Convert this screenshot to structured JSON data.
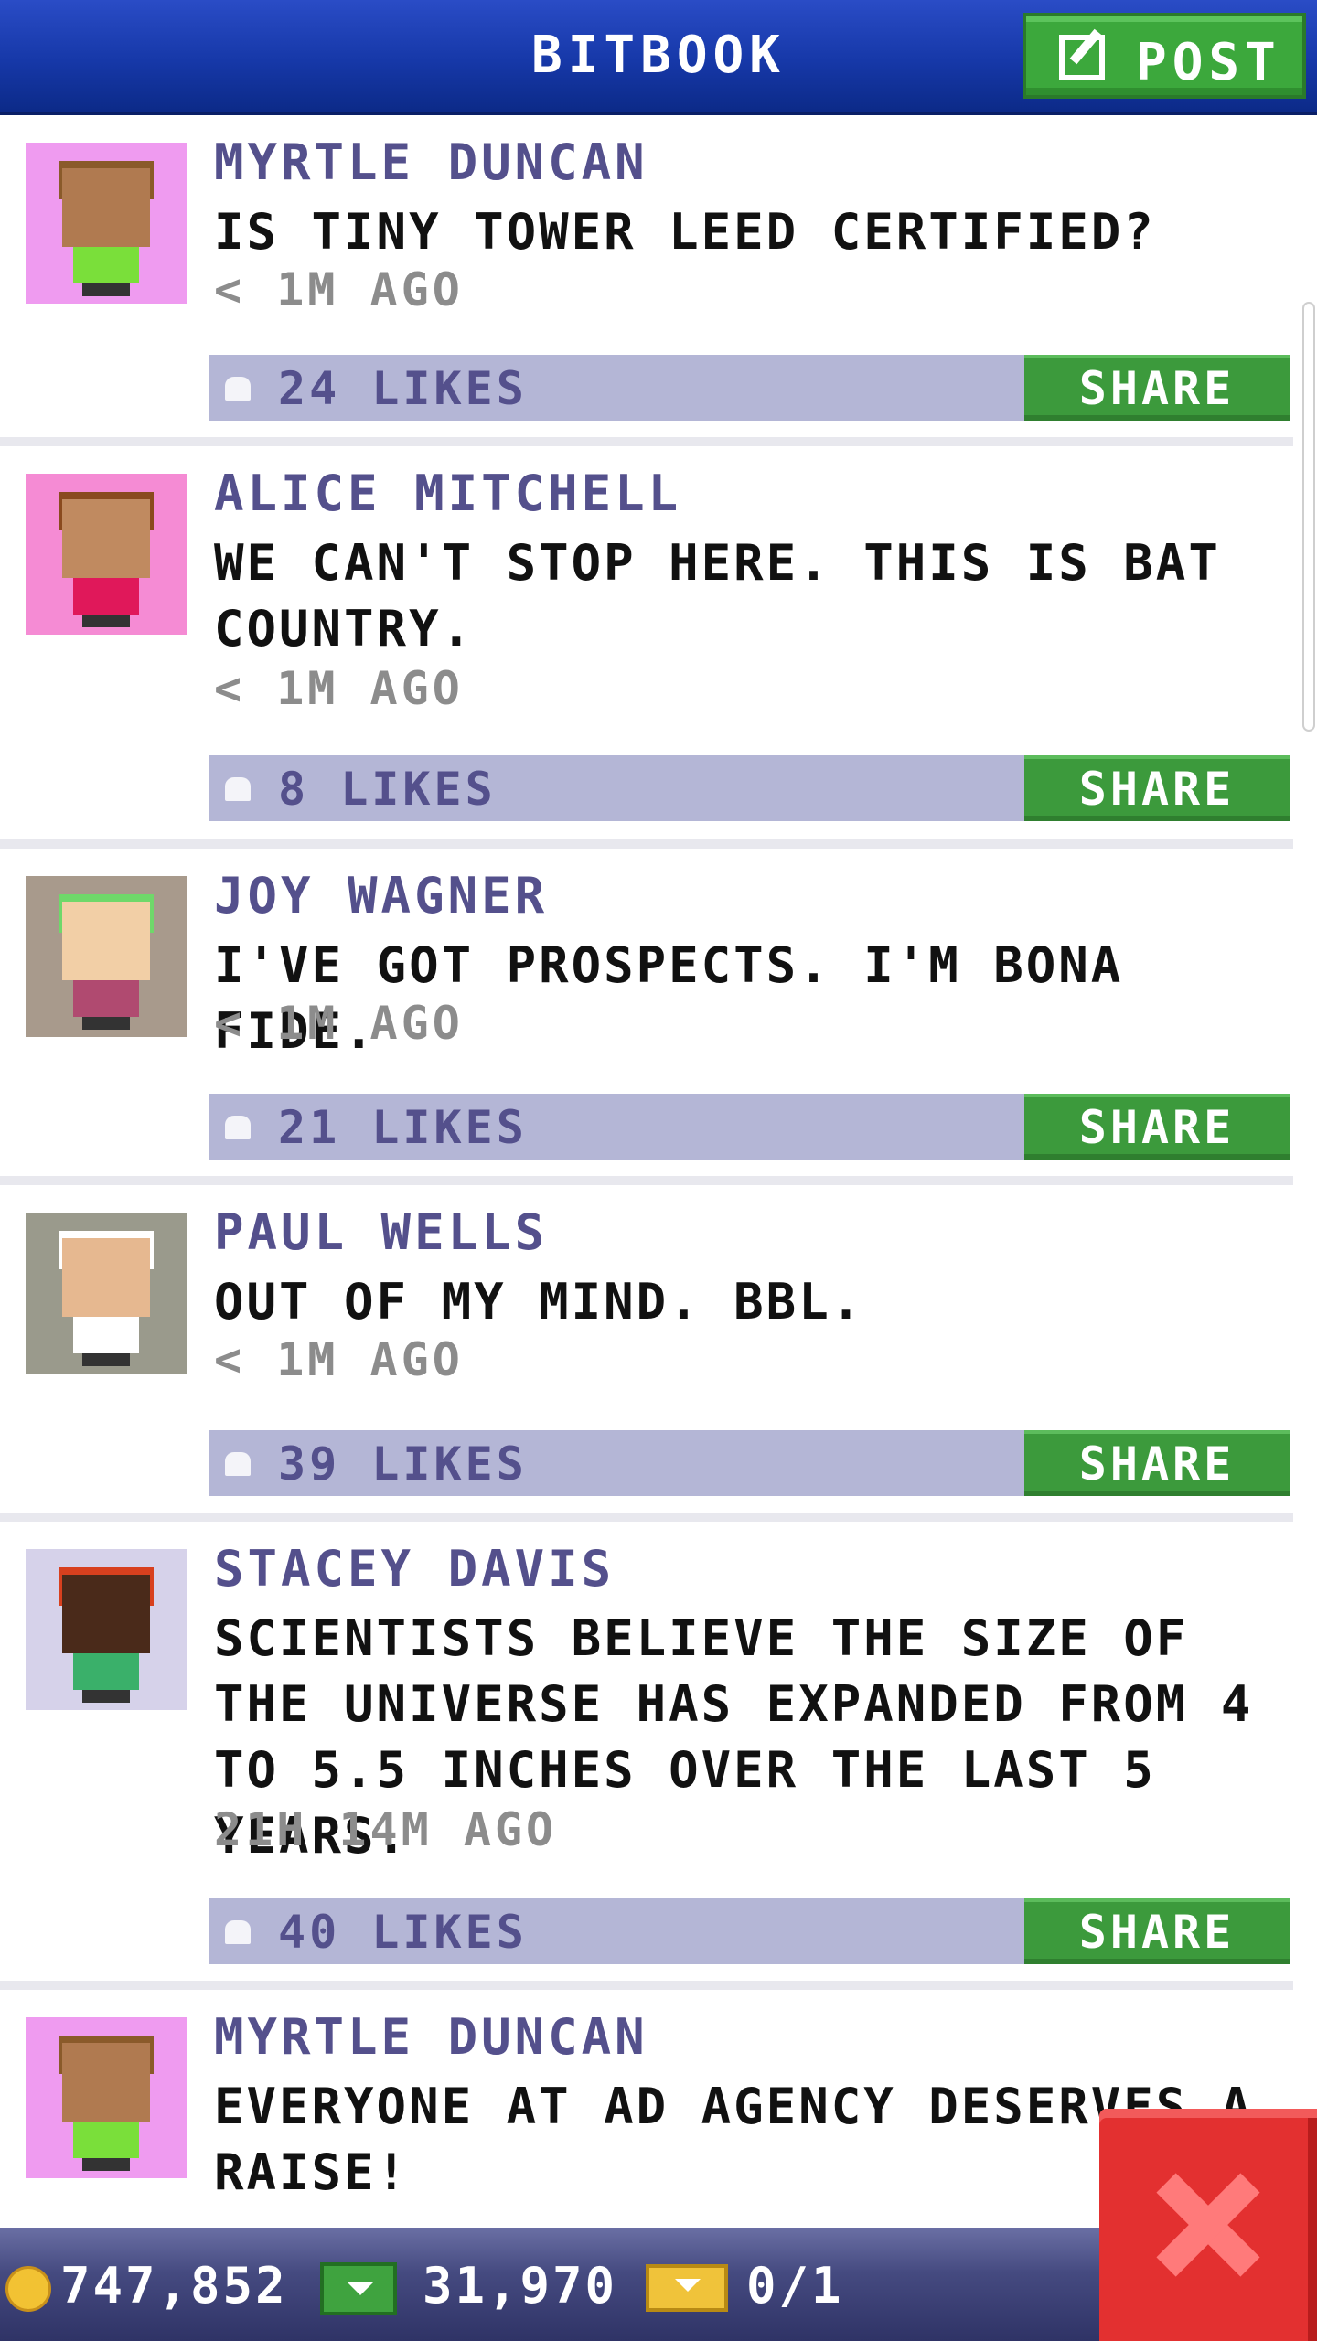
{
  "header": {
    "title": "BITBOOK",
    "post_label": "POST"
  },
  "posts": [
    {
      "author": "MYRTLE DUNCAN",
      "message": "IS TINY TOWER LEED CERTIFIED?",
      "time": "< 1M AGO",
      "likes": "24 LIKES",
      "share": "SHARE",
      "avatar_bg": "#ef9bf0",
      "hair": "#8a5a2a",
      "skin": "#b07a50",
      "shirt": "#7adf3a"
    },
    {
      "author": "ALICE MITCHELL",
      "message": "WE CAN'T STOP HERE. THIS IS BAT COUNTRY.",
      "time": "< 1M AGO",
      "likes": "8 LIKES",
      "share": "SHARE",
      "avatar_bg": "#f58bd4",
      "hair": "#8a4a1e",
      "skin": "#c08a60",
      "shirt": "#e0185a"
    },
    {
      "author": "JOY WAGNER",
      "message": "I'VE GOT PROSPECTS. I'M BONA FIDE.",
      "time": "< 1M AGO",
      "likes": "21 LIKES",
      "share": "SHARE",
      "avatar_bg": "#a89a8c",
      "hair": "#6fd86a",
      "skin": "#f2cfa6",
      "shirt": "#b04a70"
    },
    {
      "author": "PAUL WELLS",
      "message": "OUT OF MY MIND. BBL.",
      "time": "< 1M AGO",
      "likes": "39 LIKES",
      "share": "SHARE",
      "avatar_bg": "#9a9a8c",
      "hair": "#ffffff",
      "skin": "#e6b890",
      "shirt": "#ffffff"
    },
    {
      "author": "STACEY DAVIS",
      "message": "SCIENTISTS BELIEVE THE SIZE OF THE UNIVERSE HAS EXPANDED FROM 4 TO 5.5 INCHES OVER THE LAST 5 YEARS.",
      "time": "21H 14M AGO",
      "likes": "40 LIKES",
      "share": "SHARE",
      "avatar_bg": "#d6d2ea",
      "hair": "#d8401e",
      "skin": "#4a2a1a",
      "shirt": "#3ab06a"
    },
    {
      "author": "MYRTLE DUNCAN",
      "message": "EVERYONE AT AD AGENCY DESERVES A RAISE!",
      "time": "",
      "likes": "",
      "share": "",
      "avatar_bg": "#ef9bf0",
      "hair": "#8a5a2a",
      "skin": "#b07a50",
      "shirt": "#7adf3a"
    }
  ],
  "status": {
    "coins": "747,852",
    "bux": "31,970",
    "tickets": "0/1"
  }
}
